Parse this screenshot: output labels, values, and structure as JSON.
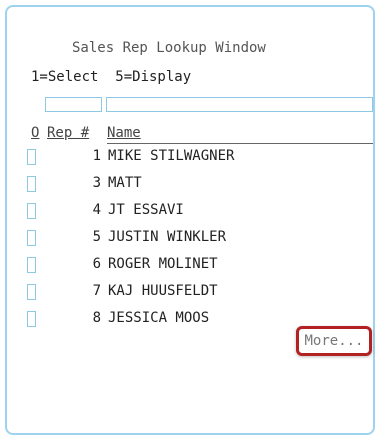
{
  "window": {
    "title": "Sales Rep Lookup Window",
    "options": "1=Select  5=Display"
  },
  "filters": {
    "rep_value": "",
    "name_value": ""
  },
  "columns": {
    "option": "O",
    "rep": "Rep #",
    "name": "Name"
  },
  "rows": [
    {
      "rep": "1",
      "name": "MIKE STILWAGNER"
    },
    {
      "rep": "3",
      "name": "MATT"
    },
    {
      "rep": "4",
      "name": "JT ESSAVI"
    },
    {
      "rep": "5",
      "name": "JUSTIN WINKLER"
    },
    {
      "rep": "6",
      "name": "ROGER MOLINET"
    },
    {
      "rep": "7",
      "name": "KAJ HUUSFELDT"
    },
    {
      "rep": "8",
      "name": "JESSICA MOOS"
    }
  ],
  "more_label": "More...",
  "colors": {
    "window_border": "#9dd3ef",
    "input_border": "#8dc9e3",
    "highlight": "#b22222"
  }
}
